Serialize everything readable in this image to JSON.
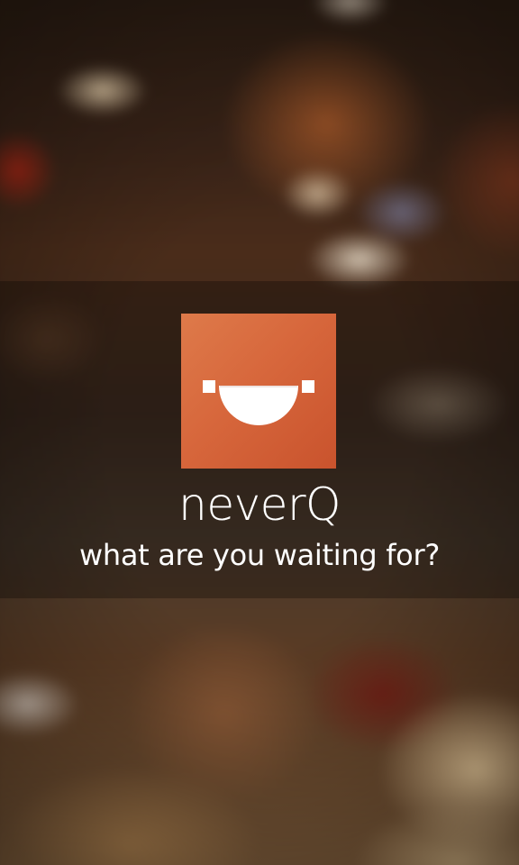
{
  "splash": {
    "app_name": "neverQ",
    "tagline": "what are you waiting for?",
    "logo_icon": "serving-bowl-icon",
    "colors": {
      "logo_tile": "#d7673c",
      "logo_tile_highlight": "#de7a4a",
      "logo_tile_shadow": "#c9532d",
      "text": "#ffffff",
      "band_overlay": "rgba(0,0,0,0.28)"
    }
  }
}
